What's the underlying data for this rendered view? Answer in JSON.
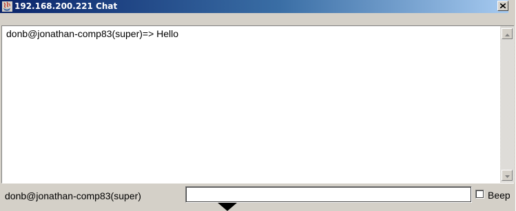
{
  "window": {
    "title": "192.168.200.221 Chat",
    "title_icon": "java-app-icon",
    "close_icon": "close-icon"
  },
  "chat": {
    "messages": [
      "donb@jonathan-comp83(super)=> Hello"
    ]
  },
  "scrollbar": {
    "up_icon": "scroll-up-arrow-icon",
    "down_icon": "scroll-down-arrow-icon"
  },
  "bottom": {
    "user_label": "donb@jonathan-comp83(super)",
    "input_value": "",
    "beep_label": "Beep",
    "beep_checked": false
  },
  "colors": {
    "titlebar_start": "#0a246a",
    "titlebar_end": "#a6caf0",
    "window_bg": "#d4d0c8"
  }
}
